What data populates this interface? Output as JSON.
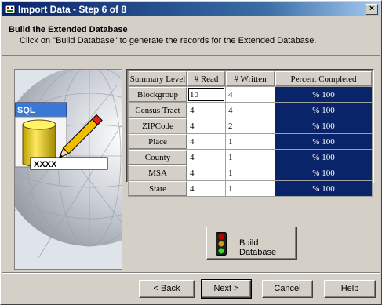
{
  "window": {
    "title": "Import Data - Step 6 of 8",
    "close_glyph": "×"
  },
  "header": {
    "title": "Build the Extended Database",
    "subtitle": "Click on \"Build Database\" to generate the records for the Extended Database."
  },
  "art": {
    "sql_label": "SQL",
    "placeholder_text": "XXXX"
  },
  "table": {
    "columns": [
      "Summary Level",
      "# Read",
      "# Written",
      "Percent Completed"
    ],
    "rows": [
      {
        "level": "Blockgroup",
        "read": "10",
        "written": "4",
        "percent": "% 100"
      },
      {
        "level": "Census Tract",
        "read": "4",
        "written": "4",
        "percent": "% 100"
      },
      {
        "level": "ZIPCode",
        "read": "4",
        "written": "2",
        "percent": "% 100"
      },
      {
        "level": "Place",
        "read": "4",
        "written": "1",
        "percent": "% 100"
      },
      {
        "level": "County",
        "read": "4",
        "written": "1",
        "percent": "% 100"
      },
      {
        "level": "MSA",
        "read": "4",
        "written": "1",
        "percent": "% 100"
      },
      {
        "level": "State",
        "read": "4",
        "written": "1",
        "percent": "% 100"
      }
    ]
  },
  "build_button": {
    "label": "Build Database",
    "icon": "traffic-light-icon"
  },
  "footer": {
    "back_prefix": "< ",
    "back_access": "B",
    "back_rest": "ack",
    "next_access": "N",
    "next_rest": "ext >",
    "cancel": "Cancel",
    "help": "Help"
  },
  "colors": {
    "title_start": "#0a246a",
    "title_end": "#a6caf0",
    "progress": "#0a246a",
    "face": "#d4d0c8"
  }
}
